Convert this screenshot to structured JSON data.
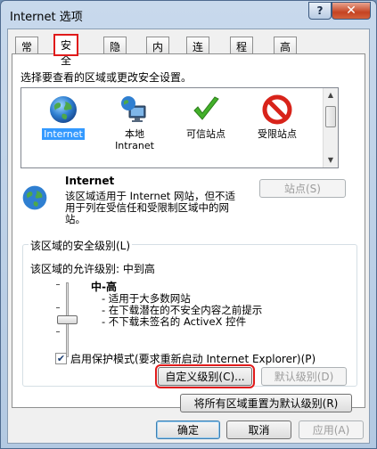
{
  "window": {
    "title": "Internet 选项",
    "help_label": "?",
    "close_label": "✕"
  },
  "tabs": [
    "常规",
    "安全",
    "隐私",
    "内容",
    "连接",
    "程序",
    "高级"
  ],
  "security": {
    "instruction": "选择要查看的区域或更改安全设置。",
    "zones": [
      {
        "label": "Internet",
        "label2": "",
        "icon": "globe-icon",
        "selected": true
      },
      {
        "label": "本地",
        "label2": "Intranet",
        "icon": "local-intranet-icon",
        "selected": false
      },
      {
        "label": "可信站点",
        "label2": "",
        "icon": "checkmark-icon",
        "selected": false
      },
      {
        "label": "受限站点",
        "label2": "",
        "icon": "no-entry-icon",
        "selected": false
      }
    ],
    "zone_info": {
      "name": "Internet",
      "description": "该区域适用于 Internet 网站，但不适用于列在受信任和受限制区域中的网站。"
    },
    "sites_button": "站点(S)",
    "group_label": "该区域的安全级别(L)",
    "allowed_levels": "该区域的允许级别: 中到高",
    "level_title": "中-高",
    "level_points": [
      "- 适用于大多数网站",
      "- 在下载潜在的不安全内容之前提示",
      "- 不下载未签名的 ActiveX 控件"
    ],
    "slider_level_fraction": 0.5,
    "protected_mode": {
      "label": "启用保护模式(要求重新启动 Internet Explorer)(P)",
      "checked": true
    },
    "custom_level_button": "自定义级别(C)...",
    "default_level_button": "默认级别(D)",
    "reset_all_button": "将所有区域重置为默认级别(R)"
  },
  "footer": {
    "ok": "确定",
    "cancel": "取消",
    "apply": "应用(A)"
  },
  "colors": {
    "highlight": "#e01b1b",
    "selection": "#3399ff"
  }
}
